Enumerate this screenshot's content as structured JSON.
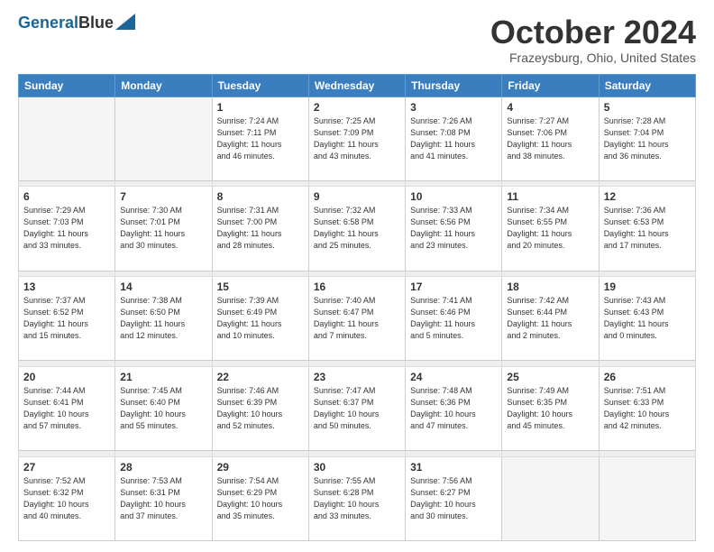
{
  "header": {
    "logo_line1": "General",
    "logo_line2": "Blue",
    "title": "October 2024",
    "subtitle": "Frazeysburg, Ohio, United States"
  },
  "days_of_week": [
    "Sunday",
    "Monday",
    "Tuesday",
    "Wednesday",
    "Thursday",
    "Friday",
    "Saturday"
  ],
  "weeks": [
    [
      {
        "day": "",
        "detail": ""
      },
      {
        "day": "",
        "detail": ""
      },
      {
        "day": "1",
        "detail": "Sunrise: 7:24 AM\nSunset: 7:11 PM\nDaylight: 11 hours\nand 46 minutes."
      },
      {
        "day": "2",
        "detail": "Sunrise: 7:25 AM\nSunset: 7:09 PM\nDaylight: 11 hours\nand 43 minutes."
      },
      {
        "day": "3",
        "detail": "Sunrise: 7:26 AM\nSunset: 7:08 PM\nDaylight: 11 hours\nand 41 minutes."
      },
      {
        "day": "4",
        "detail": "Sunrise: 7:27 AM\nSunset: 7:06 PM\nDaylight: 11 hours\nand 38 minutes."
      },
      {
        "day": "5",
        "detail": "Sunrise: 7:28 AM\nSunset: 7:04 PM\nDaylight: 11 hours\nand 36 minutes."
      }
    ],
    [
      {
        "day": "6",
        "detail": "Sunrise: 7:29 AM\nSunset: 7:03 PM\nDaylight: 11 hours\nand 33 minutes."
      },
      {
        "day": "7",
        "detail": "Sunrise: 7:30 AM\nSunset: 7:01 PM\nDaylight: 11 hours\nand 30 minutes."
      },
      {
        "day": "8",
        "detail": "Sunrise: 7:31 AM\nSunset: 7:00 PM\nDaylight: 11 hours\nand 28 minutes."
      },
      {
        "day": "9",
        "detail": "Sunrise: 7:32 AM\nSunset: 6:58 PM\nDaylight: 11 hours\nand 25 minutes."
      },
      {
        "day": "10",
        "detail": "Sunrise: 7:33 AM\nSunset: 6:56 PM\nDaylight: 11 hours\nand 23 minutes."
      },
      {
        "day": "11",
        "detail": "Sunrise: 7:34 AM\nSunset: 6:55 PM\nDaylight: 11 hours\nand 20 minutes."
      },
      {
        "day": "12",
        "detail": "Sunrise: 7:36 AM\nSunset: 6:53 PM\nDaylight: 11 hours\nand 17 minutes."
      }
    ],
    [
      {
        "day": "13",
        "detail": "Sunrise: 7:37 AM\nSunset: 6:52 PM\nDaylight: 11 hours\nand 15 minutes."
      },
      {
        "day": "14",
        "detail": "Sunrise: 7:38 AM\nSunset: 6:50 PM\nDaylight: 11 hours\nand 12 minutes."
      },
      {
        "day": "15",
        "detail": "Sunrise: 7:39 AM\nSunset: 6:49 PM\nDaylight: 11 hours\nand 10 minutes."
      },
      {
        "day": "16",
        "detail": "Sunrise: 7:40 AM\nSunset: 6:47 PM\nDaylight: 11 hours\nand 7 minutes."
      },
      {
        "day": "17",
        "detail": "Sunrise: 7:41 AM\nSunset: 6:46 PM\nDaylight: 11 hours\nand 5 minutes."
      },
      {
        "day": "18",
        "detail": "Sunrise: 7:42 AM\nSunset: 6:44 PM\nDaylight: 11 hours\nand 2 minutes."
      },
      {
        "day": "19",
        "detail": "Sunrise: 7:43 AM\nSunset: 6:43 PM\nDaylight: 11 hours\nand 0 minutes."
      }
    ],
    [
      {
        "day": "20",
        "detail": "Sunrise: 7:44 AM\nSunset: 6:41 PM\nDaylight: 10 hours\nand 57 minutes."
      },
      {
        "day": "21",
        "detail": "Sunrise: 7:45 AM\nSunset: 6:40 PM\nDaylight: 10 hours\nand 55 minutes."
      },
      {
        "day": "22",
        "detail": "Sunrise: 7:46 AM\nSunset: 6:39 PM\nDaylight: 10 hours\nand 52 minutes."
      },
      {
        "day": "23",
        "detail": "Sunrise: 7:47 AM\nSunset: 6:37 PM\nDaylight: 10 hours\nand 50 minutes."
      },
      {
        "day": "24",
        "detail": "Sunrise: 7:48 AM\nSunset: 6:36 PM\nDaylight: 10 hours\nand 47 minutes."
      },
      {
        "day": "25",
        "detail": "Sunrise: 7:49 AM\nSunset: 6:35 PM\nDaylight: 10 hours\nand 45 minutes."
      },
      {
        "day": "26",
        "detail": "Sunrise: 7:51 AM\nSunset: 6:33 PM\nDaylight: 10 hours\nand 42 minutes."
      }
    ],
    [
      {
        "day": "27",
        "detail": "Sunrise: 7:52 AM\nSunset: 6:32 PM\nDaylight: 10 hours\nand 40 minutes."
      },
      {
        "day": "28",
        "detail": "Sunrise: 7:53 AM\nSunset: 6:31 PM\nDaylight: 10 hours\nand 37 minutes."
      },
      {
        "day": "29",
        "detail": "Sunrise: 7:54 AM\nSunset: 6:29 PM\nDaylight: 10 hours\nand 35 minutes."
      },
      {
        "day": "30",
        "detail": "Sunrise: 7:55 AM\nSunset: 6:28 PM\nDaylight: 10 hours\nand 33 minutes."
      },
      {
        "day": "31",
        "detail": "Sunrise: 7:56 AM\nSunset: 6:27 PM\nDaylight: 10 hours\nand 30 minutes."
      },
      {
        "day": "",
        "detail": ""
      },
      {
        "day": "",
        "detail": ""
      }
    ]
  ]
}
